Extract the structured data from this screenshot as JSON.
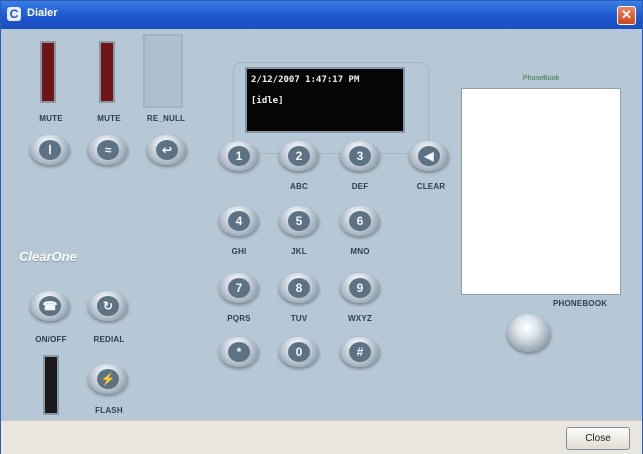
{
  "window": {
    "title": "Dialer",
    "app_icon_glyph": "C",
    "close_glyph": "✕"
  },
  "brand": "ClearOne",
  "meters": {
    "mute_left_label": "MUTE",
    "mute_right_label": "MUTE",
    "re_null_label": "RE_NULL"
  },
  "controls": {
    "on_off_label": "ON/OFF",
    "redial_label": "REDIAL",
    "flash_label": "FLASH"
  },
  "display": {
    "line1": "2/12/2007 1:47:17 PM",
    "line2": "[idle]"
  },
  "keypad": [
    {
      "digit": "1",
      "letters": ""
    },
    {
      "digit": "2",
      "letters": "ABC"
    },
    {
      "digit": "3",
      "letters": "DEF"
    },
    {
      "digit": "4",
      "letters": "GHI"
    },
    {
      "digit": "5",
      "letters": "JKL"
    },
    {
      "digit": "6",
      "letters": "MNO"
    },
    {
      "digit": "7",
      "letters": "PQRS"
    },
    {
      "digit": "8",
      "letters": "TUV"
    },
    {
      "digit": "9",
      "letters": "WXYZ"
    },
    {
      "digit": "*",
      "letters": ""
    },
    {
      "digit": "0",
      "letters": ""
    },
    {
      "digit": "#",
      "letters": ""
    }
  ],
  "clear_label": "CLEAR",
  "phonebook": {
    "title": "PhoneBook",
    "button_label": "PHONEBOOK"
  },
  "footer": {
    "close_button": "Close"
  }
}
